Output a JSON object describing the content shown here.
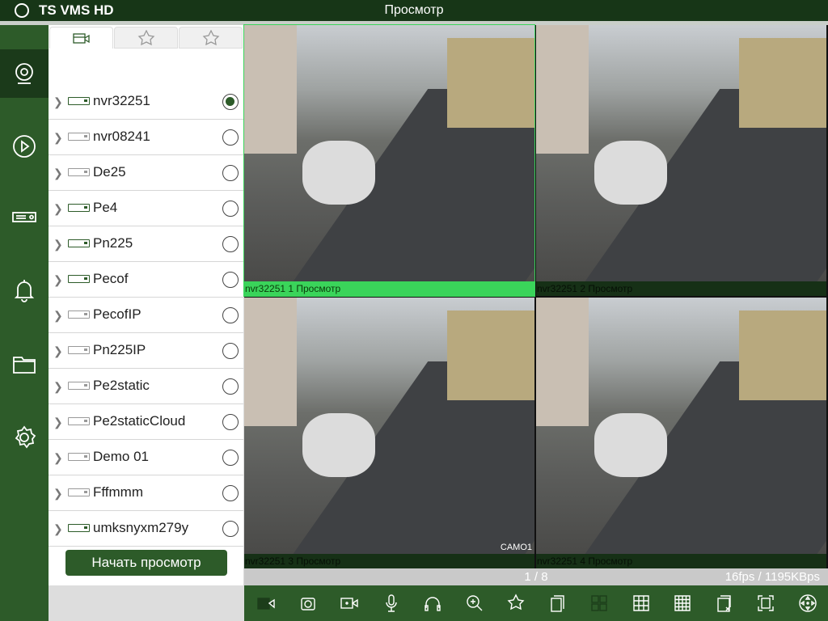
{
  "header": {
    "app_name": "TS VMS HD",
    "title": "Просмотр"
  },
  "nav": [
    "live-view",
    "playback",
    "devices",
    "alarms",
    "files",
    "settings"
  ],
  "tabs": [
    "devices",
    "favorite-cameras",
    "favorite-layouts"
  ],
  "devices": [
    {
      "name": "nvr32251",
      "online": true,
      "selected": true
    },
    {
      "name": "nvr08241",
      "online": false,
      "selected": false
    },
    {
      "name": "De25",
      "online": false,
      "selected": false
    },
    {
      "name": "Pe4",
      "online": true,
      "selected": false
    },
    {
      "name": "Pn225",
      "online": true,
      "selected": false
    },
    {
      "name": "Pecof",
      "online": true,
      "selected": false
    },
    {
      "name": "PecofIP",
      "online": false,
      "selected": false
    },
    {
      "name": "Pn225IP",
      "online": false,
      "selected": false
    },
    {
      "name": "Pe2static",
      "online": false,
      "selected": false
    },
    {
      "name": "Pe2staticCloud",
      "online": false,
      "selected": false
    },
    {
      "name": "Demo 01",
      "online": false,
      "selected": false
    },
    {
      "name": "Fffmmm",
      "online": false,
      "selected": false
    },
    {
      "name": "umksnyxm279y",
      "online": true,
      "selected": false
    }
  ],
  "start_button": "Начать просмотр",
  "tiles": [
    {
      "label": "nvr32251 1  Просмотр",
      "selected": true
    },
    {
      "label": "nvr32251 2  Просмотр",
      "selected": false
    },
    {
      "label": "nvr32251 3  Просмотр",
      "selected": false,
      "overlay": "CAMO1"
    },
    {
      "label": "nvr32251 4  Просмотр",
      "selected": false
    }
  ],
  "status": {
    "page": "1 / 8",
    "rate": "16fps / 1195KBps"
  },
  "colors": {
    "primary": "#2d5b29",
    "dark": "#173617",
    "selected_tile": "#3ad45a"
  }
}
